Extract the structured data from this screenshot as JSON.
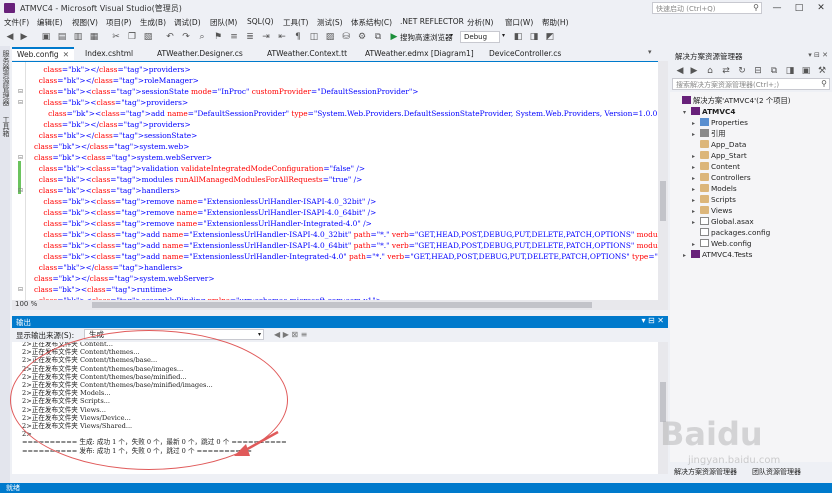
{
  "window": {
    "title": "ATMVC4 - Microsoft Visual Studio(管理员)",
    "quick_launch_placeholder": "快速启动 (Ctrl+Q)",
    "min": "—",
    "max": "□",
    "close": "✕"
  },
  "menu": [
    "文件(F)",
    "编辑(E)",
    "视图(V)",
    "项目(P)",
    "生成(B)",
    "调试(D)",
    "团队(M)",
    "SQL(Q)",
    "工具(T)",
    "测试(S)",
    "体系结构(C)",
    ".NET REFLECTOR",
    "分析(N)",
    "窗口(W)",
    "帮助(H)"
  ],
  "toolbar": {
    "config": "Debug",
    "browser": "搜狗高速浏览器"
  },
  "left_strip": [
    "服务器资源管理器",
    "工具箱"
  ],
  "doc_tabs": [
    {
      "label": "Web.config",
      "active": true,
      "close": "✕"
    },
    {
      "label": "Index.cshtml"
    },
    {
      "label": "ATWeather.Designer.cs"
    },
    {
      "label": "ATWeather.Context.tt"
    },
    {
      "label": "ATWeather.edmx [Diagram1]"
    },
    {
      "label": "DeviceController.cs"
    }
  ],
  "code": [
    "    </providers>",
    "  </roleManager>",
    "  <sessionState mode=\"InProc\" customProvider=\"DefaultSessionProvider\">",
    "    <providers>",
    "      <add name=\"DefaultSessionProvider\" type=\"System.Web.Providers.DefaultSessionStateProvider, System.Web.Providers, Version=1.0.0",
    "    </providers>",
    "  </sessionState>",
    "</system.web>",
    "<system.webServer>",
    "  <validation validateIntegratedModeConfiguration=\"false\" />",
    "  <modules runAllManagedModulesForAllRequests=\"true\" />",
    "  <handlers>",
    "    <remove name=\"ExtensionlessUrlHandler-ISAPI-4.0_32bit\" />",
    "    <remove name=\"ExtensionlessUrlHandler-ISAPI-4.0_64bit\" />",
    "    <remove name=\"ExtensionlessUrlHandler-Integrated-4.0\" />",
    "    <add name=\"ExtensionlessUrlHandler-ISAPI-4.0_32bit\" path=\"*.\" verb=\"GET,HEAD,POST,DEBUG,PUT,DELETE,PATCH,OPTIONS\" modules=\"Isapi",
    "    <add name=\"ExtensionlessUrlHandler-ISAPI-4.0_64bit\" path=\"*.\" verb=\"GET,HEAD,POST,DEBUG,PUT,DELETE,PATCH,OPTIONS\" modules=\"Isapi",
    "    <add name=\"ExtensionlessUrlHandler-Integrated-4.0\" path=\"*.\" verb=\"GET,HEAD,POST,DEBUG,PUT,DELETE,PATCH,OPTIONS\" type=\"System.We",
    "  </handlers>",
    "</system.webServer>",
    "<runtime>",
    "  <assemblyBinding xmlns=\"urn:schemas-microsoft-com:asm.v1\">"
  ],
  "zoom": "100 %",
  "output": {
    "title": "输出",
    "source_label": "显示输出来源(S):",
    "source_value": "生成",
    "lines": [
      "2>正在发布文件夹 Content...",
      "2>正在发布文件夹 Content/themes...",
      "2>正在发布文件夹 Content/themes/base...",
      "2>正在发布文件夹 Content/themes/base/images...",
      "2>正在发布文件夹 Content/themes/base/minified...",
      "2>正在发布文件夹 Content/themes/base/minified/images...",
      "2>正在发布文件夹 Models...",
      "2>正在发布文件夹 Scripts...",
      "2>正在发布文件夹 Views...",
      "2>正在发布文件夹 Views/Device...",
      "2>正在发布文件夹 Views/Shared...",
      "2>",
      "========== 生成: 成功 1 个，失败 0 个，最新 0 个，跳过 0 个 ==========",
      "========== 发布: 成功 1 个，失败 0 个，跳过 0 个 =========="
    ]
  },
  "solution_explorer": {
    "title": "解决方案资源管理器",
    "search_placeholder": "搜索解决方案资源管理器(Ctrl+;)",
    "items": [
      {
        "label": "解决方案'ATMVC4'(2 个项目)",
        "indent": 0,
        "icon": "solution",
        "exp": ""
      },
      {
        "label": "ATMVC4",
        "indent": 1,
        "icon": "proj",
        "exp": "▾",
        "bold": true
      },
      {
        "label": "Properties",
        "indent": 2,
        "icon": "prop",
        "exp": "▸"
      },
      {
        "label": "引用",
        "indent": 2,
        "icon": "ref",
        "exp": "▸"
      },
      {
        "label": "App_Data",
        "indent": 2,
        "icon": "folder",
        "exp": ""
      },
      {
        "label": "App_Start",
        "indent": 2,
        "icon": "folder",
        "exp": "▸"
      },
      {
        "label": "Content",
        "indent": 2,
        "icon": "folder",
        "exp": "▸"
      },
      {
        "label": "Controllers",
        "indent": 2,
        "icon": "folder",
        "exp": "▸"
      },
      {
        "label": "Models",
        "indent": 2,
        "icon": "folder",
        "exp": "▸"
      },
      {
        "label": "Scripts",
        "indent": 2,
        "icon": "folder",
        "exp": "▸"
      },
      {
        "label": "Views",
        "indent": 2,
        "icon": "folder",
        "exp": "▸"
      },
      {
        "label": "Global.asax",
        "indent": 2,
        "icon": "file",
        "exp": "▸"
      },
      {
        "label": "packages.config",
        "indent": 2,
        "icon": "file",
        "exp": ""
      },
      {
        "label": "Web.config",
        "indent": 2,
        "icon": "file",
        "exp": "▸"
      },
      {
        "label": "ATMVC4.Tests",
        "indent": 1,
        "icon": "proj",
        "exp": "▸"
      }
    ],
    "bottom_tabs": [
      "解决方案资源管理器",
      "团队资源管理器"
    ]
  },
  "status": "就绪",
  "watermark": "Baidu",
  "watermark_sub": "jingyan.baidu.com"
}
